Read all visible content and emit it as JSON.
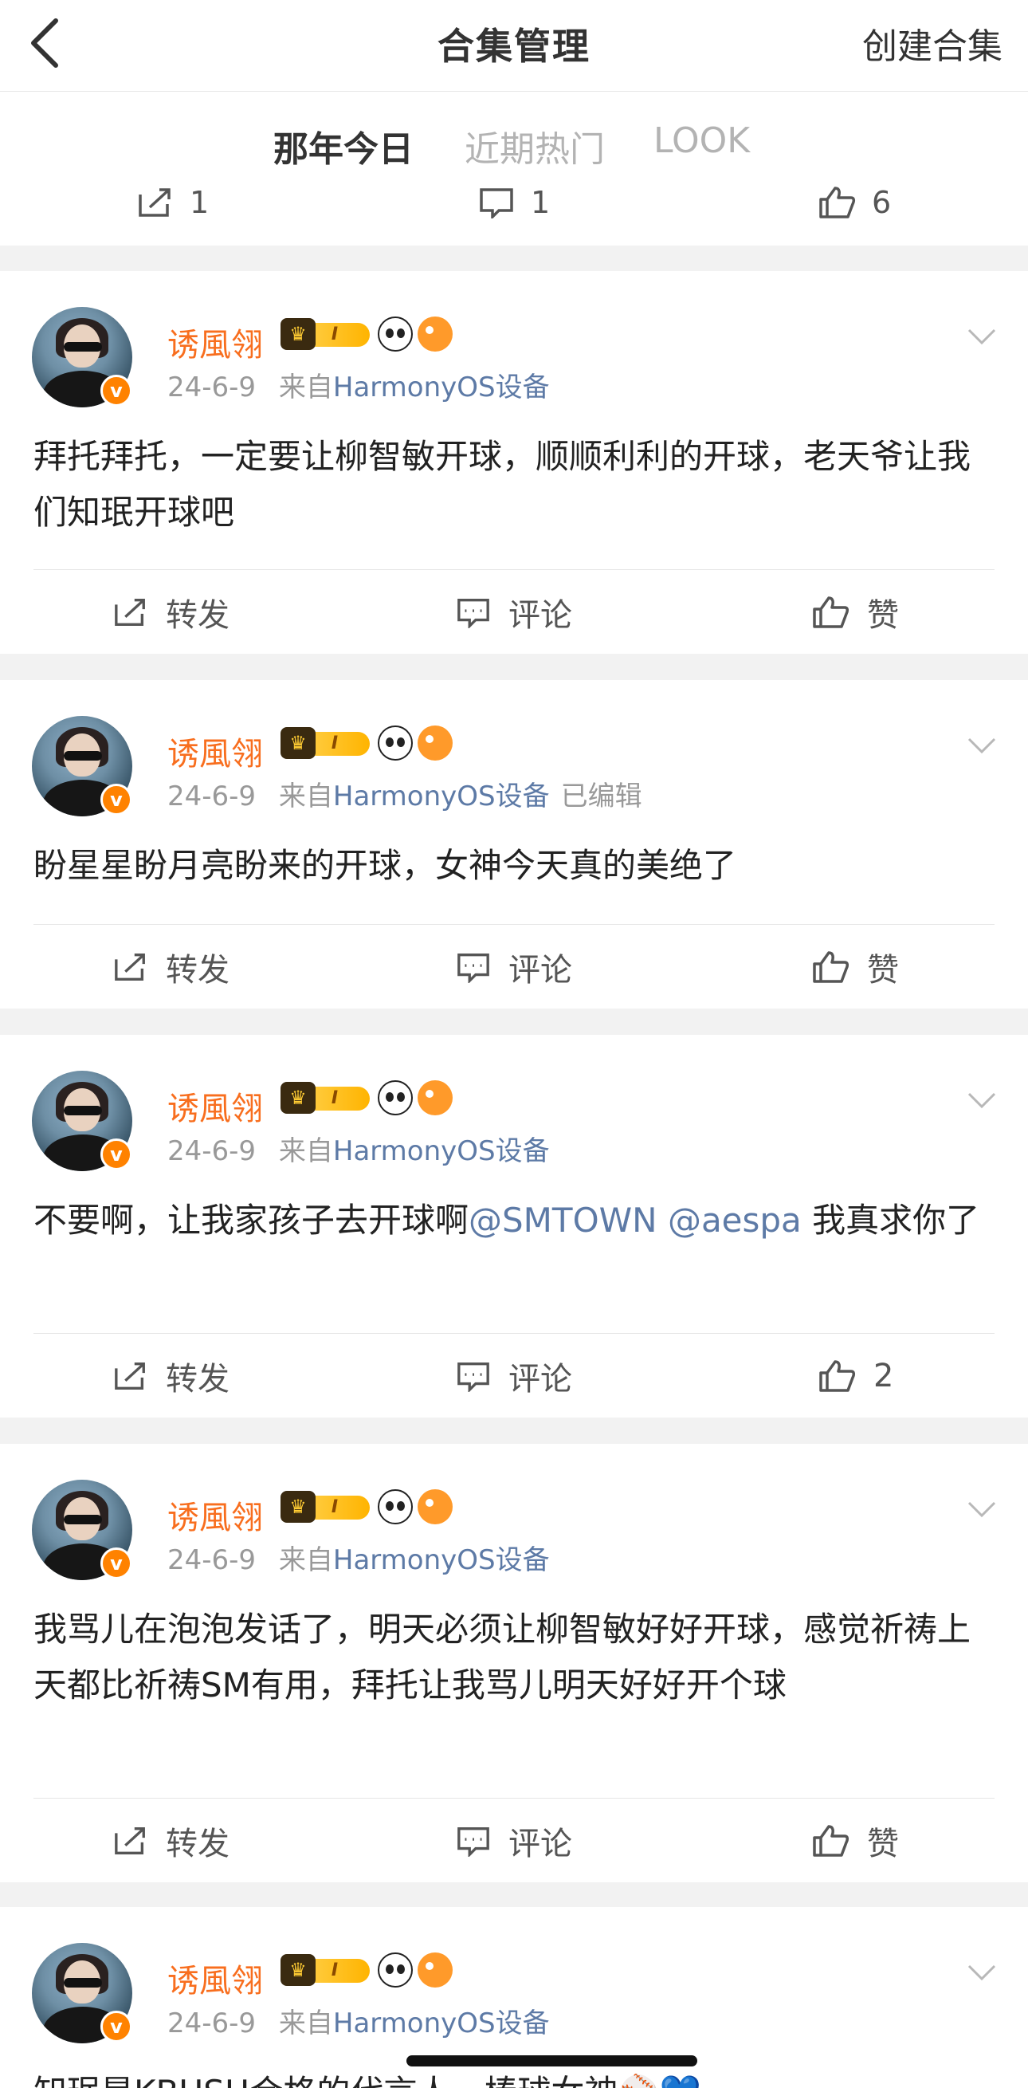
{
  "header": {
    "title": "合集管理",
    "create_label": "创建合集"
  },
  "tabs": [
    {
      "label": "那年今日",
      "active": true
    },
    {
      "label": "近期热门",
      "active": false
    },
    {
      "label": "LOOK",
      "active": false
    }
  ],
  "partial_post_actions": {
    "repost_count": "1",
    "comment_count": "1",
    "like_count": "6"
  },
  "posts": [
    {
      "username": "诱風翎",
      "date": "24-6-9",
      "from_prefix": "来自",
      "source": "HarmonyOS设备",
      "edited": "",
      "content": "拜托拜托，一定要让柳智敏开球，顺顺利利的开球，老天爷让我们知珉开球吧",
      "repost_label": "转发",
      "comment_label": "评论",
      "like_label": "赞"
    },
    {
      "username": "诱風翎",
      "date": "24-6-9",
      "from_prefix": "来自",
      "source": "HarmonyOS设备",
      "edited": "已编辑",
      "content": "盼星星盼月亮盼来的开球，女神今天真的美绝了",
      "repost_label": "转发",
      "comment_label": "评论",
      "like_label": "赞"
    },
    {
      "username": "诱風翎",
      "date": "24-6-9",
      "from_prefix": "来自",
      "source": "HarmonyOS设备",
      "edited": "",
      "content_parts": [
        "不要啊，让我家孩子去开球啊",
        "@SMTOWN",
        " ",
        "@aespa",
        " 我真求你了"
      ],
      "repost_label": "转发",
      "comment_label": "评论",
      "like_label": "2"
    },
    {
      "username": "诱風翎",
      "date": "24-6-9",
      "from_prefix": "来自",
      "source": "HarmonyOS设备",
      "edited": "",
      "content": "我骂儿在泡泡发话了，明天必须让柳智敏好好开球，感觉祈祷上天都比祈祷SM有用，拜托让我骂儿明天好好开个球",
      "repost_label": "转发",
      "comment_label": "评论",
      "like_label": "赞"
    },
    {
      "username": "诱風翎",
      "date": "24-6-9",
      "from_prefix": "来自",
      "source": "HarmonyOS设备",
      "edited": "",
      "content": "知珉是KBUSH合格的代言人，棒球女神⚾💙"
    }
  ],
  "badges": {
    "vip_level": "I",
    "verified_mark": "v"
  },
  "colors": {
    "accent": "#ff8200",
    "username": "#f86e1e",
    "link": "#5d7aa6"
  }
}
